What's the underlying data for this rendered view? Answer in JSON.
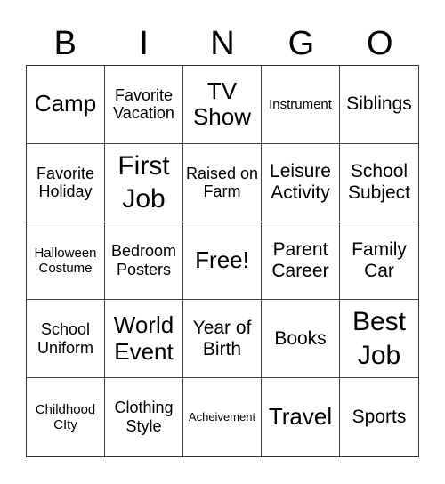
{
  "title_letters": [
    "B",
    "I",
    "N",
    "G",
    "O"
  ],
  "cells": [
    {
      "text": "Camp",
      "size": "s-xl"
    },
    {
      "text": "Favorite Vacation",
      "size": "s-md"
    },
    {
      "text": "TV Show",
      "size": "s-xl"
    },
    {
      "text": "Instrument",
      "size": "s-sm"
    },
    {
      "text": "Siblings",
      "size": "s-lg"
    },
    {
      "text": "Favorite Holiday",
      "size": "s-md"
    },
    {
      "text": "First Job",
      "size": "s-xxl"
    },
    {
      "text": "Raised on Farm",
      "size": "s-md"
    },
    {
      "text": "Leisure Activity",
      "size": "s-lg"
    },
    {
      "text": "School Subject",
      "size": "s-lg"
    },
    {
      "text": "Halloween Costume",
      "size": "s-sm"
    },
    {
      "text": "Bedroom Posters",
      "size": "s-md"
    },
    {
      "text": "Free!",
      "size": "s-xl"
    },
    {
      "text": "Parent Career",
      "size": "s-lg"
    },
    {
      "text": "Family Car",
      "size": "s-lg"
    },
    {
      "text": "School Uniform",
      "size": "s-md"
    },
    {
      "text": "World Event",
      "size": "s-xl"
    },
    {
      "text": "Year of Birth",
      "size": "s-lg"
    },
    {
      "text": "Books",
      "size": "s-lg"
    },
    {
      "text": "Best Job",
      "size": "s-xxl"
    },
    {
      "text": "Childhood CIty",
      "size": "s-sm"
    },
    {
      "text": "Clothing Style",
      "size": "s-md"
    },
    {
      "text": "Acheivement",
      "size": "s-xs"
    },
    {
      "text": "Travel",
      "size": "s-xl"
    },
    {
      "text": "Sports",
      "size": "s-lg"
    }
  ]
}
